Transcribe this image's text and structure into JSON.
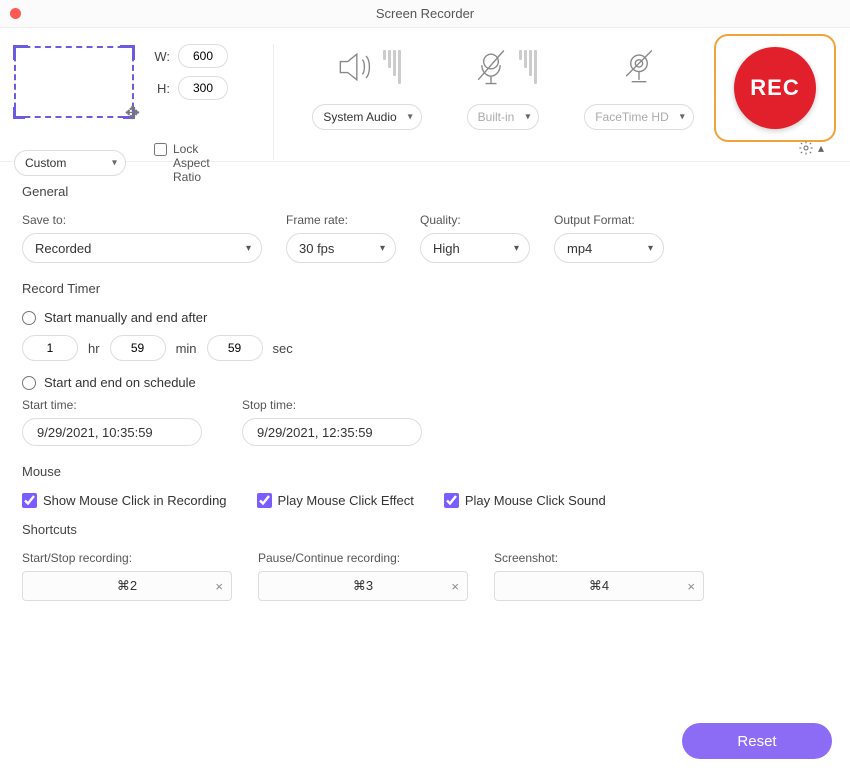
{
  "title": "Screen Recorder",
  "region": {
    "w_label": "W:",
    "h_label": "H:",
    "w": "600",
    "h": "300",
    "mode": "Custom",
    "lock_label": "Lock Aspect Ratio"
  },
  "audio": {
    "select": "System Audio"
  },
  "mic": {
    "select": "Built-in"
  },
  "cam": {
    "select": "FaceTime HD"
  },
  "rec_label": "REC",
  "general": {
    "heading": "General",
    "save_to_label": "Save to:",
    "save_to": "Recorded",
    "frame_rate_label": "Frame rate:",
    "frame_rate": "30 fps",
    "quality_label": "Quality:",
    "quality": "High",
    "format_label": "Output Format:",
    "format": "mp4"
  },
  "timer": {
    "heading": "Record Timer",
    "manual_label": "Start manually and end after",
    "hr": "1",
    "hr_unit": "hr",
    "min": "59",
    "min_unit": "min",
    "sec": "59",
    "sec_unit": "sec",
    "sched_label": "Start and end on schedule",
    "start_label": "Start time:",
    "start_time": "9/29/2021, 10:35:59",
    "stop_label": "Stop time:",
    "stop_time": "9/29/2021, 12:35:59"
  },
  "mouse": {
    "heading": "Mouse",
    "show_click": "Show Mouse Click in Recording",
    "play_effect": "Play Mouse Click Effect",
    "play_sound": "Play Mouse Click Sound"
  },
  "shortcuts": {
    "heading": "Shortcuts",
    "start_label": "Start/Stop recording:",
    "start_key": "⌘2",
    "pause_label": "Pause/Continue recording:",
    "pause_key": "⌘3",
    "shot_label": "Screenshot:",
    "shot_key": "⌘4"
  },
  "reset": "Reset"
}
